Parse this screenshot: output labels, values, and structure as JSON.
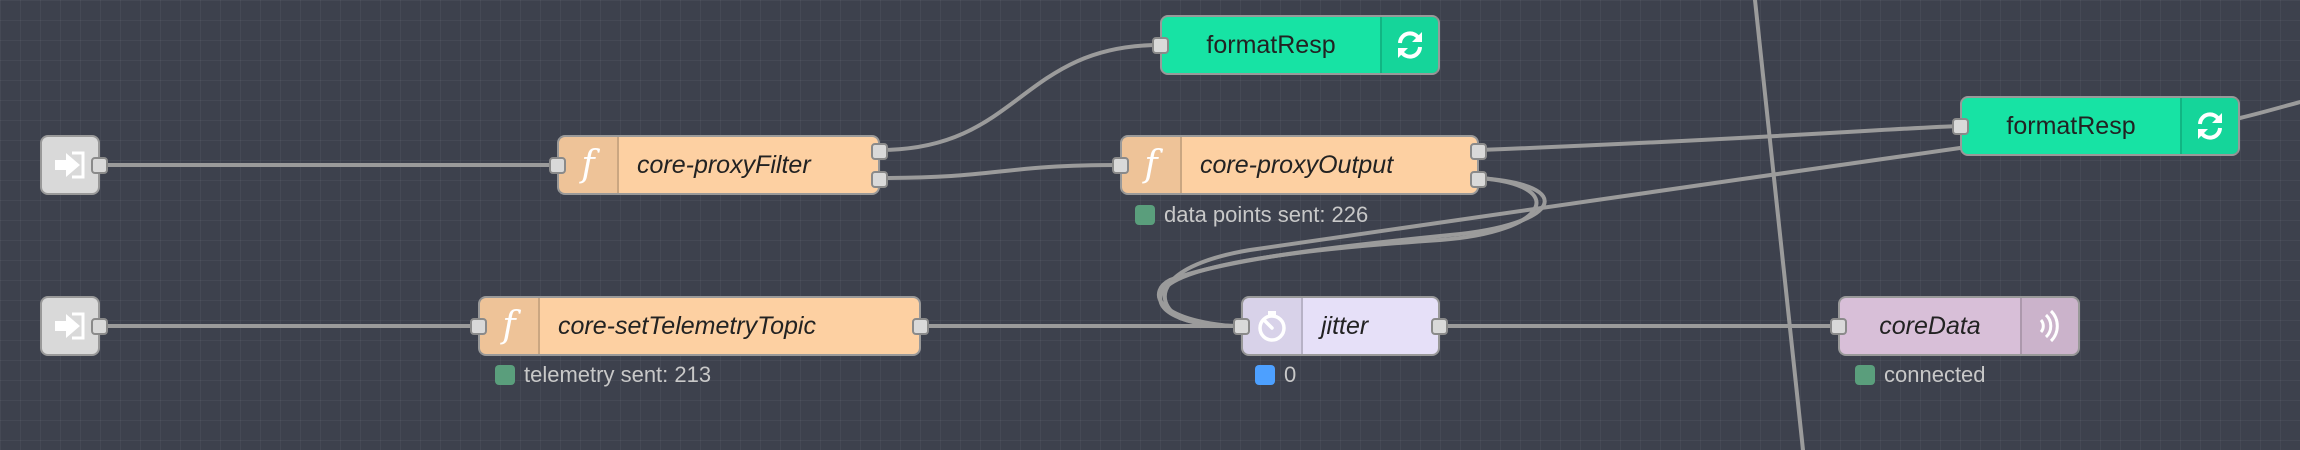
{
  "colors": {
    "canvas": "#3d414d",
    "wire": "#9b9b9b",
    "function_node": "#fdd0a2",
    "template_node": "#17e3a4",
    "delay_node": "#e6e0f8",
    "mqtt_node": "#d8bfd8",
    "link_node": "#d9d9d9",
    "status_green": "#5a9e7c",
    "status_blue": "#4da0ff"
  },
  "nodes": {
    "link_in_1": {
      "icon": "link-in-icon"
    },
    "link_in_2": {
      "icon": "link-in-icon"
    },
    "proxy_filter": {
      "label": "core-proxyFilter",
      "icon": "function-icon"
    },
    "proxy_output": {
      "label": "core-proxyOutput",
      "icon": "function-icon",
      "status": "data points sent: 226",
      "status_color": "#5a9e7c"
    },
    "set_telemetry": {
      "label": "core-setTelemetryTopic",
      "icon": "function-icon",
      "status": "telemetry sent: 213",
      "status_color": "#5a9e7c"
    },
    "format_resp_1": {
      "label": "formatResp",
      "icon": "refresh-icon"
    },
    "format_resp_2": {
      "label": "formatResp",
      "icon": "refresh-icon"
    },
    "jitter": {
      "label": "jitter",
      "icon": "timer-icon",
      "status": "0",
      "status_color": "#4da0ff"
    },
    "core_data": {
      "label": "coreData",
      "icon": "broadcast-icon",
      "status": "connected",
      "status_color": "#5a9e7c"
    }
  }
}
